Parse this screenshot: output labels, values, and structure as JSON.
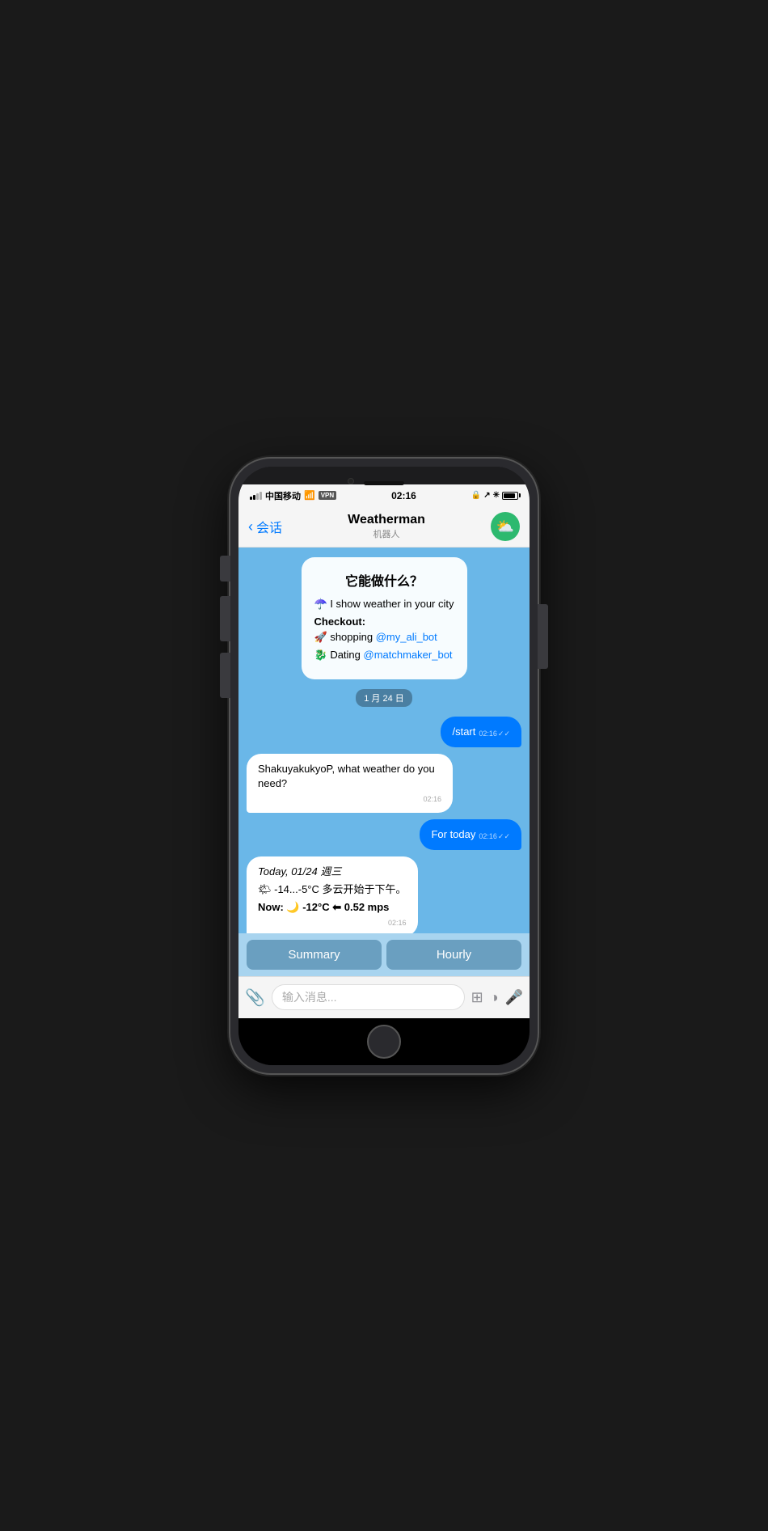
{
  "status_bar": {
    "carrier": "中国移动",
    "wifi": "📶",
    "vpn": "VPN",
    "time": "02:16",
    "battery_pct": 85
  },
  "nav": {
    "back_label": "会话",
    "title": "Weatherman",
    "subtitle": "机器人",
    "avatar_emoji": "⛅"
  },
  "messages": [
    {
      "type": "intro",
      "title": "它能做什么？",
      "line1_emoji": "☂️",
      "line1_text": "I show weather in your city",
      "checkout_label": "Checkout:",
      "link1_emoji": "🚀",
      "link1_text": "shopping ",
      "link1_handle": "@my_ali_bot",
      "link2_emoji": "🐉",
      "link2_text": "Dating ",
      "link2_handle": "@matchmaker_bot"
    },
    {
      "type": "date_badge",
      "text": "1 月 24 日"
    },
    {
      "type": "user",
      "text": "/start",
      "time": "02:16",
      "check": "✓✓"
    },
    {
      "type": "bot",
      "text": "ShakuyakukyoP, what weather do you need?",
      "time": "02:16"
    },
    {
      "type": "user",
      "text": "For today",
      "time": "02:16",
      "check": "✓✓"
    },
    {
      "type": "weather",
      "date_line": "Today, 01/24 週三",
      "temp_line": "🌤 -14...-5°C 多云开始于下午。",
      "now_label": "Now:",
      "now_emoji": "🌙",
      "now_temp": "-12°C",
      "now_wind_emoji": "⬅",
      "now_wind": "0.52 mps",
      "time": "02:16"
    }
  ],
  "buttons": [
    {
      "label": "Summary"
    },
    {
      "label": "Hourly"
    }
  ],
  "input": {
    "placeholder": "输入消息..."
  }
}
